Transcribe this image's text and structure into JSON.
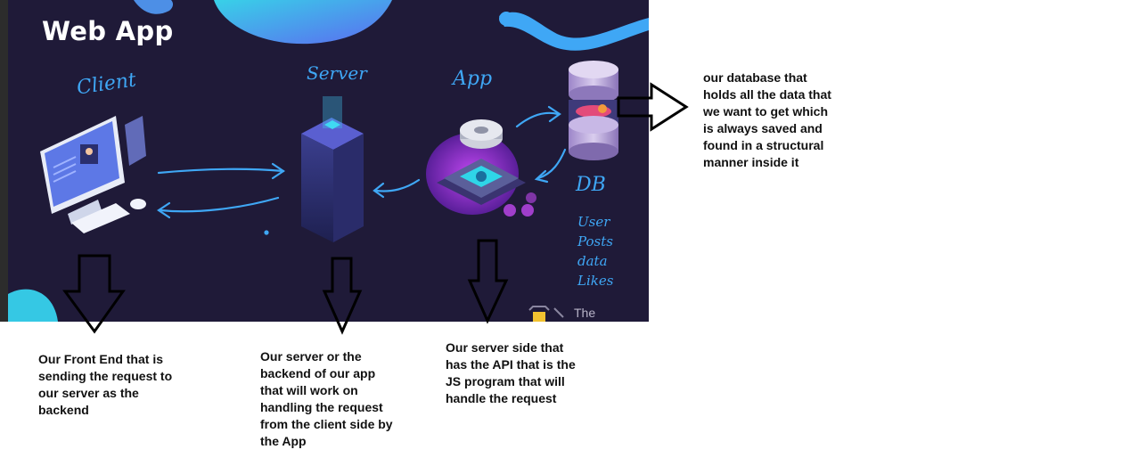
{
  "diagram": {
    "title": "Web App",
    "labels": {
      "client": "Client",
      "server": "Server",
      "app": "App",
      "db": "DB",
      "db_fields": [
        "User",
        "Posts",
        "data",
        "Likes"
      ],
      "brand": "The"
    },
    "annotations": {
      "db_note": "our database that\nholds all the data that\nwe want to get which\nis always saved and\nfound in a structural\nmanner inside it",
      "client_note": "Our Front End that is\nsending the request to\nour server as the\nbackend",
      "server_note": "Our server or the\nbackend of our app\nthat will work on\nhandling the request\nfrom the client side by\nthe App",
      "app_note": "Our server side that\nhas the API that is the\nJS program that will\nhandle the request"
    },
    "colors": {
      "background": "#1f1a38",
      "accent_blue": "#3fa7f5",
      "accent_cyan": "#2fd6e8",
      "accent_purple": "#8b2fc9"
    }
  }
}
